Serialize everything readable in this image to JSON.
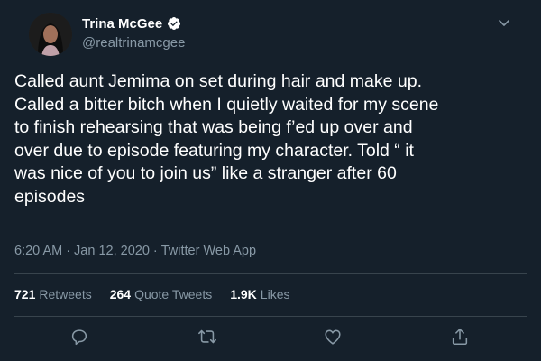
{
  "author": {
    "display_name": "Trina McGee",
    "handle": "@realtrinamcgee"
  },
  "tweet": {
    "lines": [
      "Called aunt Jemima on set during hair and make up.",
      "Called a bitter bitch when I quietly waited for my scene",
      "to finish rehearsing that was being f’ed up over and",
      "over due to episode featuring my character. Told “ it",
      "was nice of you to join us” like a stranger after 60",
      "episodes"
    ]
  },
  "meta": {
    "time": "6:20 AM",
    "separator1": "·",
    "date": "Jan 12, 2020",
    "separator2": "·",
    "app": "Twitter Web App"
  },
  "stats": {
    "retweets_count": "721",
    "retweets_label": "Retweets",
    "quotes_count": "264",
    "quotes_label": "Quote Tweets",
    "likes_count": "1.9K",
    "likes_label": "Likes"
  },
  "icons": {
    "verified": "verified-badge-icon",
    "caret": "chevron-down-icon",
    "reply": "reply-icon",
    "retweet": "retweet-icon",
    "like": "heart-icon",
    "share": "share-icon"
  },
  "colors": {
    "background": "#15202b",
    "text": "#ffffff",
    "secondary": "#8899a6",
    "divider": "#38444d",
    "verified": "#ffffff"
  }
}
